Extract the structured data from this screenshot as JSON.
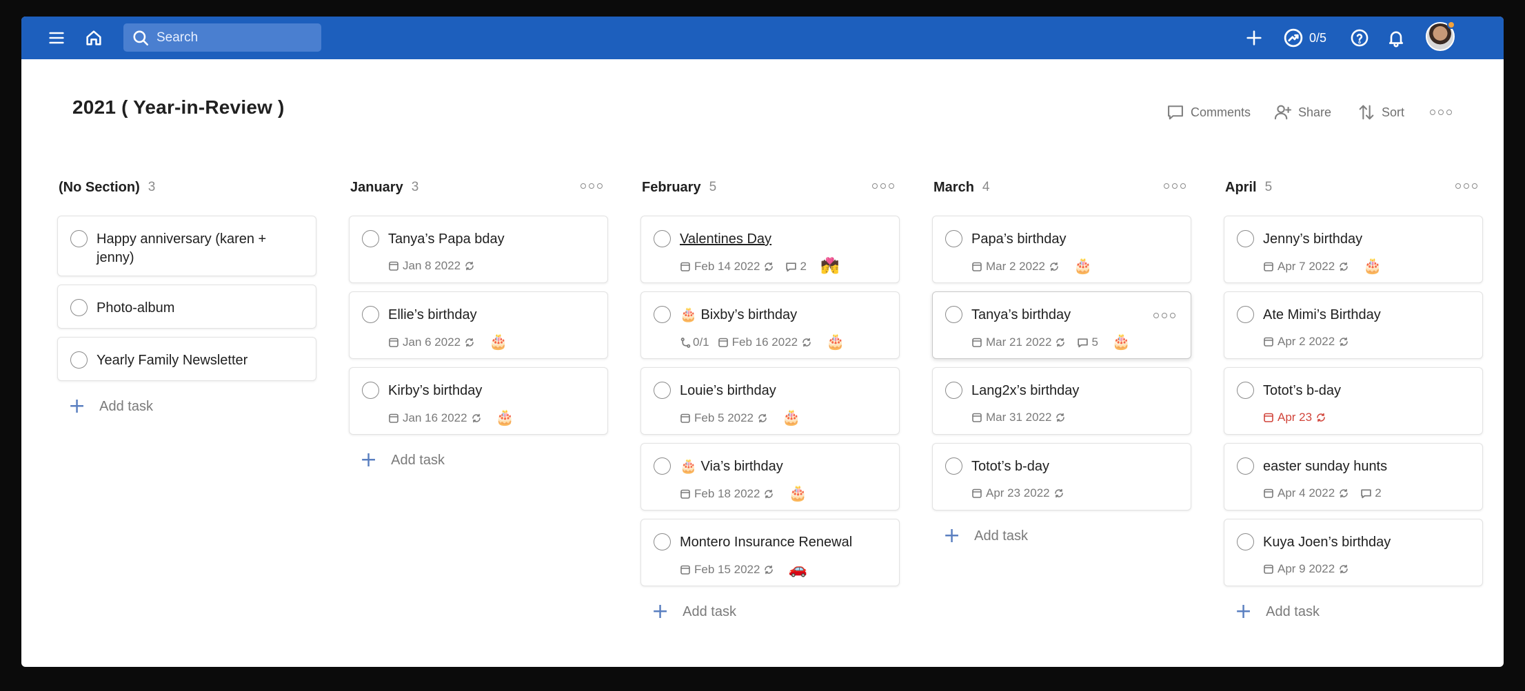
{
  "topbar": {
    "search_placeholder": "Search",
    "karma": "0/5",
    "icons": [
      "menu-icon",
      "home-icon",
      "search-icon",
      "plus-icon",
      "karma-icon",
      "help-icon",
      "bell-icon"
    ]
  },
  "project": {
    "title": "2021 ( Year-in-Review )",
    "actions": {
      "comments": "Comments",
      "share": "Share",
      "sort": "Sort"
    }
  },
  "add_task_label": "Add task",
  "columns": [
    {
      "title": "(No Section)",
      "count": "3",
      "tasks": [
        {
          "title": "Happy anniversary (karen + jenny)"
        },
        {
          "title": "Photo-album"
        },
        {
          "title": "Yearly Family Newsletter"
        }
      ]
    },
    {
      "title": "January",
      "count": "3",
      "tasks": [
        {
          "title": "Tanya’s Papa bday",
          "date": "Jan 8 2022"
        },
        {
          "title": "Ellie’s birthday",
          "date": "Jan 6 2022",
          "emoji": "🎂"
        },
        {
          "title": "Kirby’s birthday",
          "date": "Jan 16 2022",
          "emoji": "🎂"
        }
      ]
    },
    {
      "title": "February",
      "count": "5",
      "tasks": [
        {
          "title": "Valentines Day",
          "date": "Feb 14 2022",
          "comments": "2",
          "emoji": "💏"
        },
        {
          "title": "🎂 Bixby’s birthday",
          "subtasks": "0/1",
          "date": "Feb 16 2022",
          "emoji": "🎂"
        },
        {
          "title": "Louie’s birthday",
          "date": "Feb 5 2022",
          "emoji": "🎂"
        },
        {
          "title": "🎂 Via’s birthday",
          "date": "Feb 18 2022",
          "emoji": "🎂"
        },
        {
          "title": "Montero Insurance Renewal",
          "date": "Feb 15 2022",
          "emoji": "🚗"
        }
      ]
    },
    {
      "title": "March",
      "count": "4",
      "tasks": [
        {
          "title": "Papa’s birthday",
          "date": "Mar 2 2022",
          "emoji": "🎂"
        },
        {
          "title": "Tanya’s birthday",
          "date": "Mar 21 2022",
          "comments": "5",
          "emoji": "🎂"
        },
        {
          "title": "Lang2x’s birthday",
          "date": "Mar 31 2022"
        },
        {
          "title": "Totot’s b-day",
          "date": "Apr 23 2022"
        }
      ]
    },
    {
      "title": "April",
      "count": "5",
      "tasks": [
        {
          "title": "Jenny’s birthday",
          "date": "Apr 7 2022",
          "emoji": "🎂"
        },
        {
          "title": "Ate Mimi’s Birthday",
          "date": "Apr 2 2022"
        },
        {
          "title": "Totot’s b-day",
          "date": "Apr 23",
          "overdue_color": "#d1453b"
        },
        {
          "title": "easter sunday hunts",
          "date": "Apr 4 2022",
          "comments": "2"
        },
        {
          "title": "Kuya Joen’s birthday",
          "date": "Apr 9 2022"
        }
      ]
    }
  ],
  "colors": {
    "topbar": "#1d5fbd",
    "accent_plus": "#5a7fc0",
    "overdue": "#d1453b"
  }
}
